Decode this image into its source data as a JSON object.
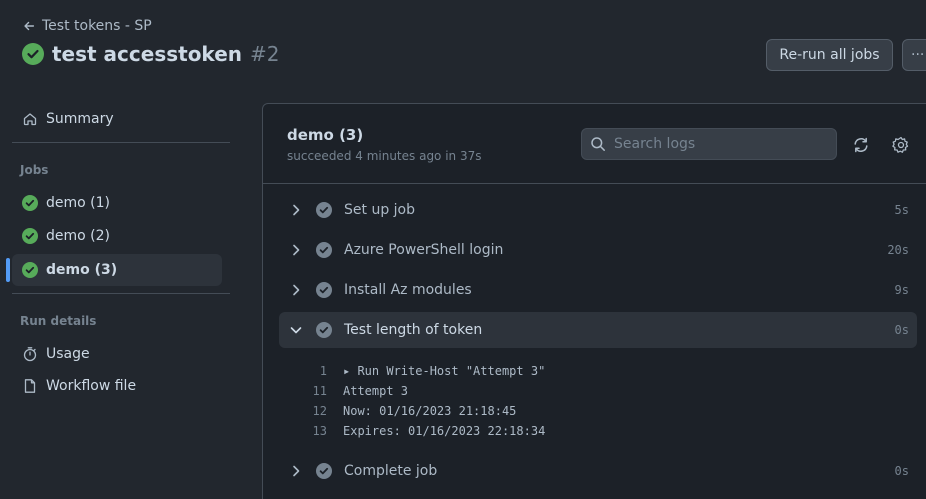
{
  "header": {
    "back_label": "Test tokens - SP",
    "title": "test accesstoken",
    "run_number": "#2",
    "rerun_label": "Re-run all jobs",
    "more_label": "···"
  },
  "sidebar": {
    "summary_label": "Summary",
    "jobs_heading": "Jobs",
    "jobs": [
      {
        "label": "demo (1)"
      },
      {
        "label": "demo (2)"
      },
      {
        "label": "demo (3)"
      }
    ],
    "run_details_heading": "Run details",
    "usage_label": "Usage",
    "workflow_label": "Workflow file"
  },
  "job": {
    "title": "demo (3)",
    "subtitle": "succeeded 4 minutes ago in 37s",
    "search_placeholder": "Search logs"
  },
  "steps": [
    {
      "name": "Set up job",
      "duration": "5s"
    },
    {
      "name": "Azure PowerShell login",
      "duration": "20s"
    },
    {
      "name": "Install Az modules",
      "duration": "9s"
    },
    {
      "name": "Test length of token",
      "duration": "0s"
    },
    {
      "name": "Complete job",
      "duration": "0s"
    }
  ],
  "log_lines": [
    {
      "num": "1",
      "text": "▸ Run Write-Host \"Attempt 3\""
    },
    {
      "num": "11",
      "text": "Attempt 3"
    },
    {
      "num": "12",
      "text": "Now: 01/16/2023 21:18:45"
    },
    {
      "num": "13",
      "text": "Expires: 01/16/2023 22:18:34"
    }
  ],
  "colors": {
    "background": "#22272e",
    "panel": "#1c2128",
    "success": "#57ab5a",
    "accent": "#539bf5"
  }
}
